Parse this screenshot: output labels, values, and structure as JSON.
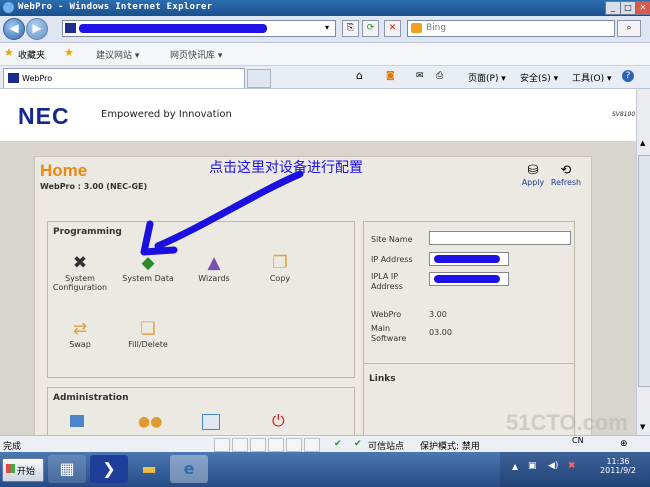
{
  "window": {
    "title": "WebPro - Windows Internet Explorer"
  },
  "address": {
    "search_placeholder": "Bing"
  },
  "favorites": {
    "label": "收藏夹",
    "items": [
      "建议网站 ▾",
      "网页快讯库 ▾"
    ]
  },
  "tab": {
    "title": "WebPro"
  },
  "toolbar": {
    "page": "页面(P) ▾",
    "safety": "安全(S) ▾",
    "tools": "工具(O) ▾"
  },
  "page": {
    "logo": "NEC",
    "tagline": "Empowered by Innovation",
    "model": "SV8100",
    "title": "Home",
    "subtitle": "WebPro : 3.00 (NEC-GE)",
    "annotation": "点击这里对设备进行配置",
    "apply": "Apply",
    "refresh": "Refresh",
    "programming": {
      "title": "Programming",
      "items": [
        {
          "label1": "System",
          "label2": "Configuration"
        },
        {
          "label1": "System Data",
          "label2": ""
        },
        {
          "label1": "Wizards",
          "label2": ""
        },
        {
          "label1": "Copy",
          "label2": ""
        },
        {
          "label1": "Swap",
          "label2": ""
        },
        {
          "label1": "Fill/Delete",
          "label2": ""
        }
      ]
    },
    "administration": {
      "title": "Administration"
    },
    "info": {
      "site_name": "Site Name",
      "ip_address": "IP Address",
      "ipla_1": "IPLA IP",
      "ipla_2": "Address",
      "webpro": "WebPro",
      "webpro_value": "3.00",
      "main_1": "Main",
      "main_2": "Software",
      "main_value": "03.00"
    },
    "links": "Links"
  },
  "status": {
    "text": "完成",
    "zone": "可信站点",
    "mode": "保护模式: 禁用"
  },
  "taskbar": {
    "start": "开始",
    "lang": "CN",
    "time": "11:36",
    "date": "2011/9/2"
  },
  "watermark": "51CTO.com",
  "colors": {
    "accent_orange": "#e58a12",
    "nec_blue": "#15278f",
    "mask_blue": "#1e12e8"
  }
}
